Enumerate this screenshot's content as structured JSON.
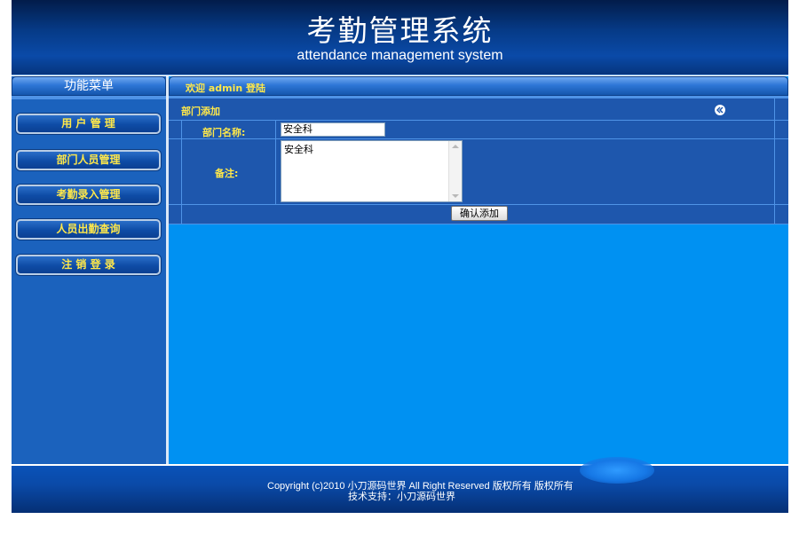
{
  "header": {
    "title": "考勤管理系统",
    "subtitle": "attendance management system"
  },
  "sidebar": {
    "heading": "功能菜单",
    "items": [
      {
        "label": "用 户 管 理"
      },
      {
        "label": "部门人员管理"
      },
      {
        "label": "考勤录入管理"
      },
      {
        "label": "人员出勤查询"
      },
      {
        "label": "注 销 登 录"
      }
    ]
  },
  "welcome": {
    "text": "欢迎 admin 登陆"
  },
  "form": {
    "title": "部门添加",
    "back_icon": "double-chevron-left-icon",
    "name_label": "部门名称:",
    "name_value": "安全科",
    "remark_label": "备注:",
    "remark_value": "安全科",
    "submit_label": "确认添加"
  },
  "footer": {
    "line1": "Copyright (c)2010  小刀源码世界  All Right Reserved  版权所有 版权所有",
    "line2": "技术支持：小刀源码世界"
  },
  "colors": {
    "accent_text": "#ffe84a",
    "main_bg": "#0091f2",
    "sidebar_bg": "#1b62bd"
  }
}
